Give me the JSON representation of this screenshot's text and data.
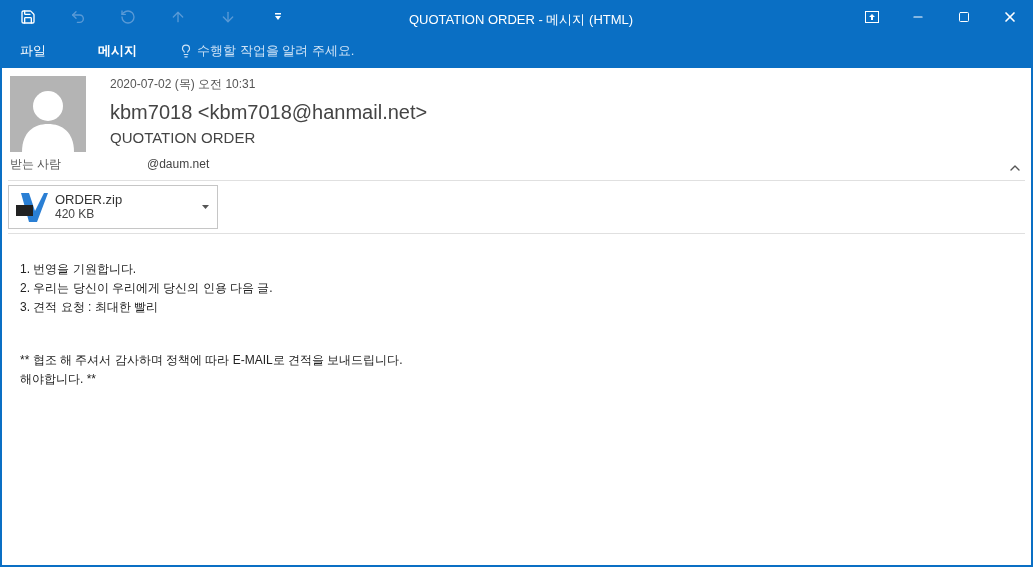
{
  "window": {
    "title": "QUOTATION ORDER - 메시지 (HTML)"
  },
  "quick_access": [
    {
      "kind": "save",
      "disabled": false
    },
    {
      "kind": "undo",
      "disabled": true
    },
    {
      "kind": "redo",
      "disabled": true
    },
    {
      "kind": "up",
      "disabled": true
    },
    {
      "kind": "down",
      "disabled": true
    },
    {
      "kind": "customize",
      "disabled": false
    }
  ],
  "ribbon_tabs": [
    {
      "label": "파일",
      "selected": false
    },
    {
      "label": "메시지",
      "selected": true
    }
  ],
  "tell_me": {
    "placeholder": "수행할 작업을 알려 주세요."
  },
  "message": {
    "date": "2020-07-02 (목) 오전 10:31",
    "sender": "kbm7018 <kbm7018@hanmail.net>",
    "subject": "QUOTATION ORDER",
    "to_label": "받는 사람",
    "to_value": "@daum.net",
    "attachment": {
      "name": "ORDER.zip",
      "size": "420 KB"
    },
    "body": [
      [
        "1. 번영을 기원합니다.",
        "2. 우리는 당신이 우리에게 당신의 인용 다음 글.",
        "3. 견적 요청 : 최대한 빨리"
      ],
      [
        "** 협조 해 주셔서 감사하며 정책에 따라 E-MAIL로 견적을 보내드립니다.",
        "해야합니다. **"
      ]
    ]
  }
}
